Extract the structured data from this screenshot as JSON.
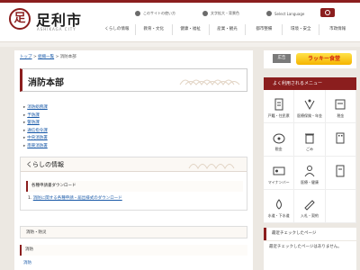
{
  "header": {
    "logo_glyph": "足",
    "site_name": "足利市",
    "site_sub": "ASHIKAGA CITY",
    "util": [
      "このサイトの使い方",
      "文字拡大・背景色",
      "Select Language"
    ],
    "nav": [
      "くらしの情報",
      "教育・文化",
      "健康・福祉",
      "産業・観光",
      "都市整備",
      "環境・安全",
      "市政情報"
    ]
  },
  "breadcrumb": [
    "トップ",
    "組織一覧",
    "消防本部"
  ],
  "page_title": "消防本部",
  "links": [
    "消防総務課",
    "予防課",
    "警防課",
    "通信指令課",
    "中央消防署",
    "南東消防署"
  ],
  "info": {
    "heading": "くらしの情報",
    "section": "各種申請書ダウンロード",
    "link_prefix": "1.",
    "link": "消防に関する各種申請・届出様式のダウンロード"
  },
  "box2": "消防・防災",
  "row3": "消防",
  "row4": "消防",
  "sidebar": {
    "ad_label": "広告",
    "banner": "ラッキー食堂",
    "menu_heading": "よく利用されるメニュー",
    "menu": [
      {
        "label": "戸籍・住民票",
        "icon": "document-icon"
      },
      {
        "label": "医療保険・年金",
        "icon": "medical-icon"
      },
      {
        "label": "税金",
        "icon": "tax-icon"
      },
      {
        "label": "税金",
        "icon": "wallet-icon"
      },
      {
        "label": "ごみ",
        "icon": "trash-icon"
      },
      {
        "label": "",
        "icon": "building-icon"
      },
      {
        "label": "マイナンバー",
        "icon": "id-card-icon"
      },
      {
        "label": "医療・健康",
        "icon": "doctor-icon"
      },
      {
        "label": "",
        "icon": "document-icon"
      },
      {
        "label": "水道・下水道",
        "icon": "water-icon"
      },
      {
        "label": "入札・契約",
        "icon": "contract-icon"
      },
      {
        "label": "",
        "icon": "blank"
      }
    ],
    "recent_heading": "最近チェックしたページ",
    "recent_body": "最近チェックしたページはありません。"
  },
  "colors": {
    "accent": "#8b1e1e",
    "link": "#1a5aa8"
  }
}
